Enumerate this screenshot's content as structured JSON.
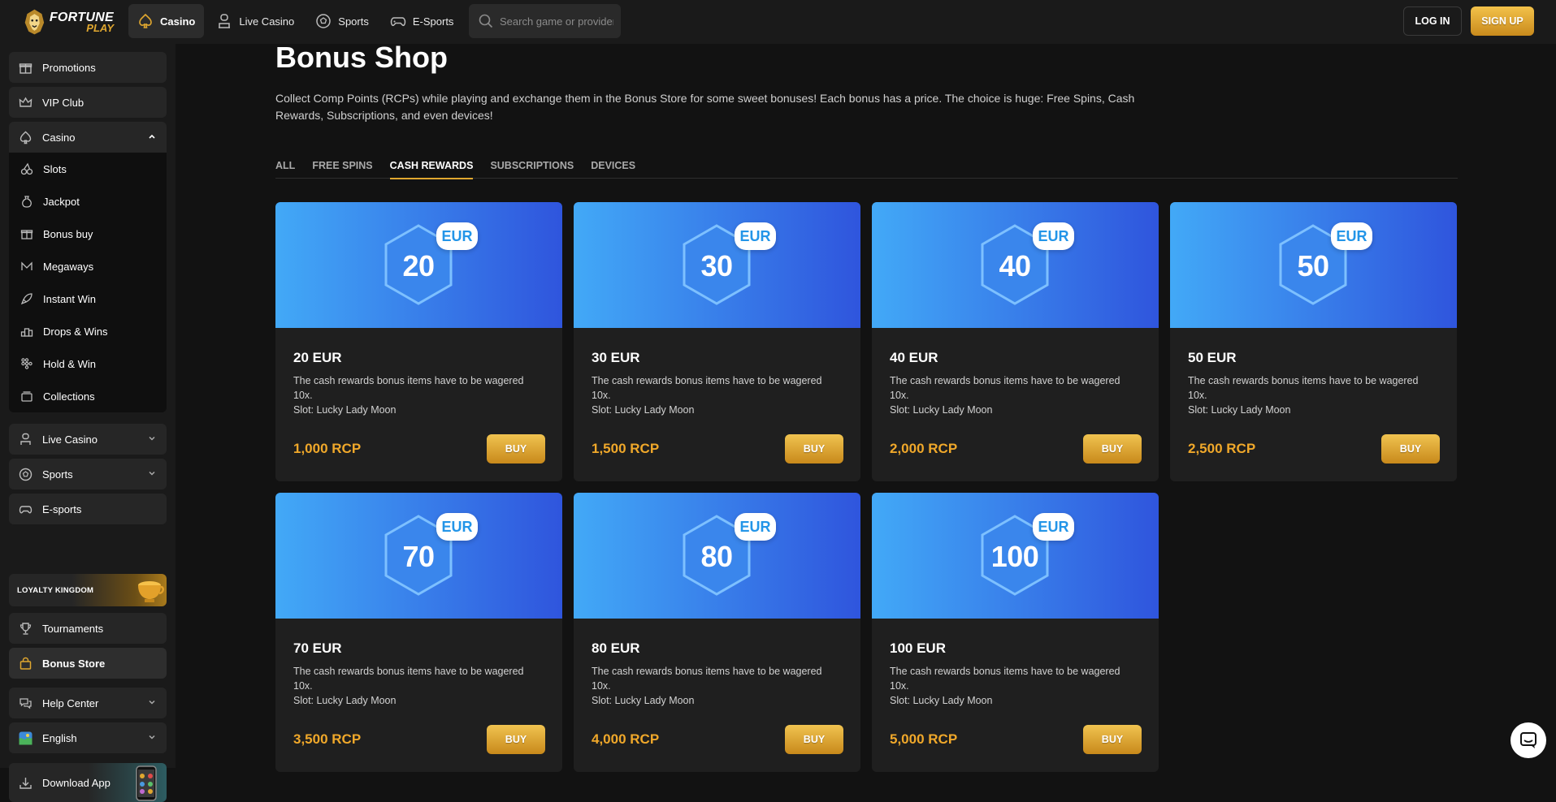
{
  "header": {
    "logo_line1": "FORTUNE",
    "logo_line2": "PLAY",
    "nav": [
      {
        "label": "Casino",
        "icon": "spade-icon"
      },
      {
        "label": "Live Casino",
        "icon": "dealer-icon"
      },
      {
        "label": "Sports",
        "icon": "soccer-ball-icon"
      },
      {
        "label": "E-Sports",
        "icon": "gamepad-icon"
      }
    ],
    "search_placeholder": "Search game or provider",
    "login_label": "LOG IN",
    "signup_label": "SIGN UP",
    "accent_color": "#e0a72f"
  },
  "sidebar": {
    "promotions": "Promotions",
    "vip_club": "VIP Club",
    "casino": "Casino",
    "casino_sub": [
      "Slots",
      "Jackpot",
      "Bonus buy",
      "Megaways",
      "Instant Win",
      "Drops & Wins",
      "Hold & Win",
      "Collections"
    ],
    "live_casino": "Live Casino",
    "sports": "Sports",
    "esports": "E-sports",
    "loyalty": "LOYALTY KINGDOM",
    "tournaments": "Tournaments",
    "bonus_store": "Bonus Store",
    "help_center": "Help Center",
    "language": "English",
    "download_app": "Download App"
  },
  "main": {
    "title": "Bonus Shop",
    "intro": "Collect Comp Points (RCPs) while playing and exchange them in the Bonus Store for some sweet bonuses! Each bonus has a price. The choice is huge: Free Spins, Cash Rewards, Subscriptions, and even devices!",
    "tabs": [
      "ALL",
      "FREE SPINS",
      "CASH REWARDS",
      "SUBSCRIPTIONS",
      "DEVICES"
    ],
    "active_tab": "CASH REWARDS",
    "currency_badge": "EUR",
    "buy_label": "BUY",
    "cards": [
      {
        "amount": "20",
        "title": "20 EUR",
        "desc": "The cash rewards bonus items have to be wagered 10x.",
        "slot": "Slot: Lucky Lady Moon",
        "price": "1,000 RCP"
      },
      {
        "amount": "30",
        "title": "30 EUR",
        "desc": "The cash rewards bonus items have to be wagered 10x.",
        "slot": "Slot: Lucky Lady Moon",
        "price": "1,500 RCP"
      },
      {
        "amount": "40",
        "title": "40 EUR",
        "desc": "The cash rewards bonus items have to be wagered 10x.",
        "slot": "Slot: Lucky Lady Moon",
        "price": "2,000 RCP"
      },
      {
        "amount": "50",
        "title": "50 EUR",
        "desc": "The cash rewards bonus items have to be wagered 10x.",
        "slot": "Slot: Lucky Lady Moon",
        "price": "2,500 RCP"
      },
      {
        "amount": "70",
        "title": "70 EUR",
        "desc": "The cash rewards bonus items have to be wagered 10x.",
        "slot": "Slot: Lucky Lady Moon",
        "price": "3,500 RCP"
      },
      {
        "amount": "80",
        "title": "80 EUR",
        "desc": "The cash rewards bonus items have to be wagered 10x.",
        "slot": "Slot: Lucky Lady Moon",
        "price": "4,000 RCP"
      },
      {
        "amount": "100",
        "title": "100 EUR",
        "desc": "The cash rewards bonus items have to be wagered 10x.",
        "slot": "Slot: Lucky Lady Moon",
        "price": "5,000 RCP"
      }
    ]
  }
}
